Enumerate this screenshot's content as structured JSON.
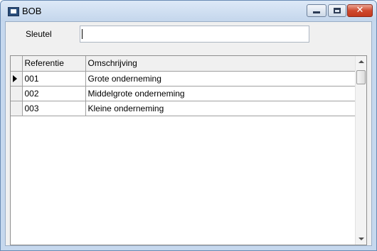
{
  "window": {
    "title": "BOB"
  },
  "icons": {
    "app": "app-window-icon",
    "minimize": "minimize-icon",
    "maximize": "maximize-icon",
    "close": "close-icon",
    "row_pointer": "row-pointer-icon",
    "scroll_up": "scroll-up-icon",
    "scroll_down": "scroll-down-icon"
  },
  "search": {
    "label": "Sleutel",
    "value": ""
  },
  "grid": {
    "columns": [
      "Referentie",
      "Omschrijving"
    ],
    "rows": [
      {
        "ref": "001",
        "desc": "Grote onderneming",
        "current": true
      },
      {
        "ref": "002",
        "desc": "Middelgrote onderneming",
        "current": false
      },
      {
        "ref": "003",
        "desc": "Kleine onderneming",
        "current": false
      }
    ]
  },
  "colors": {
    "frame": "#c6d8ee",
    "client_bg": "#f0f0f0",
    "close_button": "#c33a1f"
  }
}
